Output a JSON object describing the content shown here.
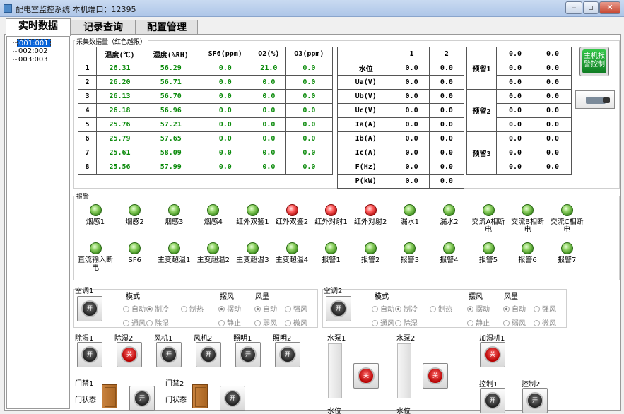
{
  "window": {
    "title": "配电室监控系统  本机端口：12395"
  },
  "tabs": [
    "实时数据",
    "记录查询",
    "配置管理"
  ],
  "tree": [
    "001:001",
    "002:002",
    "003:003"
  ],
  "collect_label": "采集数据量（红色越限）",
  "env_headers": [
    "",
    "温度(℃)",
    "湿度(%RH)",
    "SF6(ppm)",
    "O2(%)",
    "O3(ppm)"
  ],
  "env_rows": [
    [
      "1",
      "26.31",
      "56.29",
      "0.0",
      "21.0",
      "0.0"
    ],
    [
      "2",
      "26.20",
      "56.71",
      "0.0",
      "0.0",
      "0.0"
    ],
    [
      "3",
      "26.13",
      "56.70",
      "0.0",
      "0.0",
      "0.0"
    ],
    [
      "4",
      "26.18",
      "56.96",
      "0.0",
      "0.0",
      "0.0"
    ],
    [
      "5",
      "25.76",
      "57.21",
      "0.0",
      "0.0",
      "0.0"
    ],
    [
      "6",
      "25.79",
      "57.65",
      "0.0",
      "0.0",
      "0.0"
    ],
    [
      "7",
      "25.61",
      "58.09",
      "0.0",
      "0.0",
      "0.0"
    ],
    [
      "8",
      "25.56",
      "57.99",
      "0.0",
      "0.0",
      "0.0"
    ]
  ],
  "elec_headers": [
    "",
    "1",
    "2"
  ],
  "elec_rows": [
    [
      "水位",
      "0.0",
      "0.0"
    ],
    [
      "Ua(V)",
      "0.0",
      "0.0"
    ],
    [
      "Ub(V)",
      "0.0",
      "0.0"
    ],
    [
      "Uc(V)",
      "0.0",
      "0.0"
    ],
    [
      "Ia(A)",
      "0.0",
      "0.0"
    ],
    [
      "Ib(A)",
      "0.0",
      "0.0"
    ],
    [
      "Ic(A)",
      "0.0",
      "0.0"
    ],
    [
      "F(Hz)",
      "0.0",
      "0.0"
    ],
    [
      "P(kW)",
      "0.0",
      "0.0"
    ]
  ],
  "reserve": [
    {
      "label": "预留1",
      "values": [
        [
          "0.0",
          "0.0"
        ],
        [
          "0.0",
          "0.0"
        ],
        [
          "0.0",
          "0.0"
        ]
      ]
    },
    {
      "label": "预留2",
      "values": [
        [
          "0.0",
          "0.0"
        ],
        [
          "0.0",
          "0.0"
        ],
        [
          "0.0",
          "0.0"
        ]
      ]
    },
    {
      "label": "预留3",
      "values": [
        [
          "0.0",
          "0.0"
        ],
        [
          "0.0",
          "0.0"
        ],
        [
          "0.0",
          "0.0"
        ]
      ]
    }
  ],
  "main_alarm_button": "主机报警控制",
  "alarm_label": "报警",
  "alarms_row1": [
    {
      "label": "烟感1",
      "state": "green"
    },
    {
      "label": "烟感2",
      "state": "green"
    },
    {
      "label": "烟感3",
      "state": "green"
    },
    {
      "label": "烟感4",
      "state": "green"
    },
    {
      "label": "红外双鉴1",
      "state": "green"
    },
    {
      "label": "红外双鉴2",
      "state": "red"
    },
    {
      "label": "红外对射1",
      "state": "red"
    },
    {
      "label": "红外对射2",
      "state": "red"
    },
    {
      "label": "漏水1",
      "state": "green"
    },
    {
      "label": "漏水2",
      "state": "green"
    },
    {
      "label": "交流A相断电",
      "state": "green"
    },
    {
      "label": "交流B相断电",
      "state": "green"
    },
    {
      "label": "交流C相断电",
      "state": "green"
    }
  ],
  "alarms_row2": [
    {
      "label": "直流输入断电",
      "state": "green"
    },
    {
      "label": "SF6",
      "state": "green"
    },
    {
      "label": "主变超温1",
      "state": "green"
    },
    {
      "label": "主变超温2",
      "state": "green"
    },
    {
      "label": "主变超温3",
      "state": "green"
    },
    {
      "label": "主变超温4",
      "state": "green"
    },
    {
      "label": "报警1",
      "state": "green"
    },
    {
      "label": "报警2",
      "state": "green"
    },
    {
      "label": "报警3",
      "state": "green"
    },
    {
      "label": "报警4",
      "state": "green"
    },
    {
      "label": "报警5",
      "state": "green"
    },
    {
      "label": "报警6",
      "state": "green"
    },
    {
      "label": "报警7",
      "state": "green"
    }
  ],
  "ac": [
    {
      "title": "空调1",
      "switch": "开",
      "mode_label": "模式",
      "modes": [
        "自动",
        "制冷",
        "制热",
        "通风",
        "除湿"
      ],
      "mode_selected": "制冷",
      "swing_label": "摆风",
      "swings": [
        "摆动",
        "静止"
      ],
      "swing_selected": "摆动",
      "fan_label": "风量",
      "fans": [
        "自动",
        "强风",
        "弱风",
        "微风"
      ],
      "fan_selected": "自动"
    },
    {
      "title": "空调2",
      "switch": "开",
      "mode_label": "模式",
      "modes": [
        "自动",
        "制冷",
        "制热",
        "通风",
        "除湿"
      ],
      "mode_selected": "制冷",
      "swing_label": "摆风",
      "swings": [
        "摆动",
        "静止"
      ],
      "swing_selected": "摆动",
      "fan_label": "风量",
      "fans": [
        "自动",
        "强风",
        "弱风",
        "微风"
      ],
      "fan_selected": "自动"
    }
  ],
  "switches": [
    {
      "label": "除湿1",
      "btn": "开",
      "state": "off"
    },
    {
      "label": "除湿2",
      "btn": "关",
      "state": "red"
    },
    {
      "label": "风机1",
      "btn": "开",
      "state": "off"
    },
    {
      "label": "风机2",
      "btn": "开",
      "state": "off"
    },
    {
      "label": "照明1",
      "btn": "开",
      "state": "off"
    },
    {
      "label": "照明2",
      "btn": "开",
      "state": "off"
    }
  ],
  "doors": [
    {
      "title": "门禁1",
      "state_label": "门状态",
      "btn": "开"
    },
    {
      "title": "门禁2",
      "state_label": "门状态",
      "btn": "开"
    }
  ],
  "pumps": [
    {
      "title": "水泵1",
      "level_label": "水位",
      "btn": "关"
    },
    {
      "title": "水泵2",
      "level_label": "水位",
      "btn": "关"
    }
  ],
  "humidifier": {
    "title": "加湿机1",
    "btn": "关"
  },
  "controls": [
    {
      "title": "控制1",
      "btn": "开"
    },
    {
      "title": "控制2",
      "btn": "开"
    }
  ],
  "colors": {
    "green_value": "#0a8a0a",
    "tab_bg": "#e2e2e2",
    "alarm_green": "#3f8e1f",
    "alarm_red": "#b71414"
  }
}
